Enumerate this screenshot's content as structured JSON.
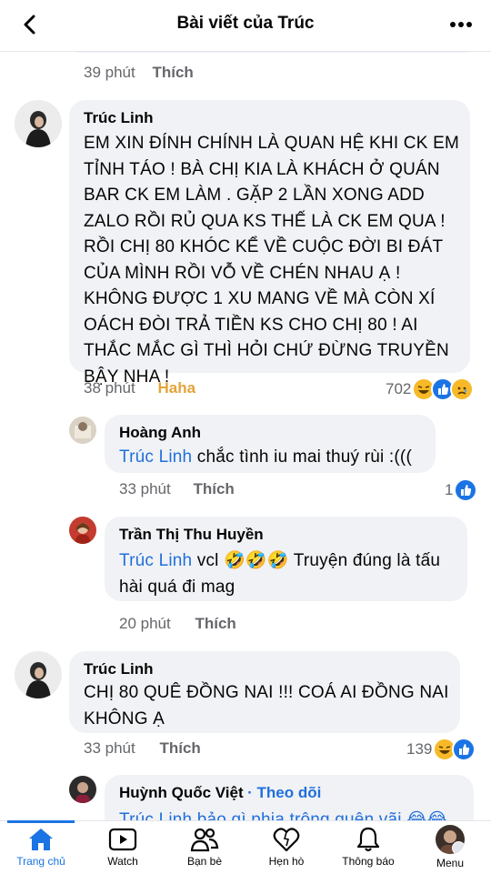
{
  "header": {
    "title": "Bài viết của Trúc"
  },
  "prev_comment_meta": {
    "time": "39 phút",
    "like": "Thích"
  },
  "comments": [
    {
      "author": "Trúc Linh",
      "text": "EM XIN ĐÍNH CHÍNH LÀ QUAN HỆ KHI CK EM TỈNH TÁO ! BÀ CHỊ KIA LÀ KHÁCH Ở QUÁN BAR CK EM LÀM . GẶP 2 LẦN XONG ADD ZALO RỒI RỦ QUA KS THẾ LÀ CK EM QUA ! RỒI CHỊ 80 KHÓC KỂ VỀ CUỘC ĐỜI BI ĐÁT CỦA MÌNH RỒI VỖ VỀ CHÉN NHAU Ạ ! KHÔNG ĐƯỢC 1 XU MANG VỀ MÀ CÒN XÍ OÁCH ĐÒI TRẢ TIỀN KS CHO CHỊ 80 ! AI THẮC MẮC GÌ THÌ HỎI CHỨ ĐỪNG TRUYỀN BẬY NHA !",
      "time": "38 phút",
      "reaction_label": "Haha",
      "reaction_count": "702"
    },
    {
      "author": "Hoàng Anh",
      "mention": "Trúc Linh",
      "text": " chắc tình iu mai thuý rùi :(((",
      "time": "33 phút",
      "like": "Thích",
      "reaction_count": "1"
    },
    {
      "author": "Trần Thị Thu Huyền",
      "mention": "Trúc Linh",
      "text_a": " vcl 🤣🤣🤣 Truyện đúng là tấu",
      "text_b": "hài quá đi mag",
      "time": "20 phút",
      "like": "Thích"
    },
    {
      "author": "Trúc Linh",
      "text": "CHỊ 80 QUÊ ĐỒNG NAI !!! COÁ AI ĐỒNG NAI KHÔNG Ạ",
      "time": "33 phút",
      "like": "Thích",
      "reaction_count": "139"
    },
    {
      "author": "Huỳnh Quốc Việt",
      "follow": "· Theo dõi",
      "partial_text": "Trúc Linh bảo gì phịa trông quên vãi 😂😂"
    }
  ],
  "nav": [
    {
      "label": "Trang chủ",
      "icon": "home-icon"
    },
    {
      "label": "Watch",
      "icon": "watch-icon"
    },
    {
      "label": "Bạn bè",
      "icon": "friends-icon"
    },
    {
      "label": "Hẹn hò",
      "icon": "dating-icon"
    },
    {
      "label": "Thông báo",
      "icon": "bell-icon"
    },
    {
      "label": "Menu",
      "icon": "menu-avatar"
    }
  ],
  "colors": {
    "accent": "#1b74e4",
    "mention": "#216fdb",
    "haha": "#e3a43a",
    "bubble": "#f0f2f5",
    "meta": "#65676b"
  }
}
